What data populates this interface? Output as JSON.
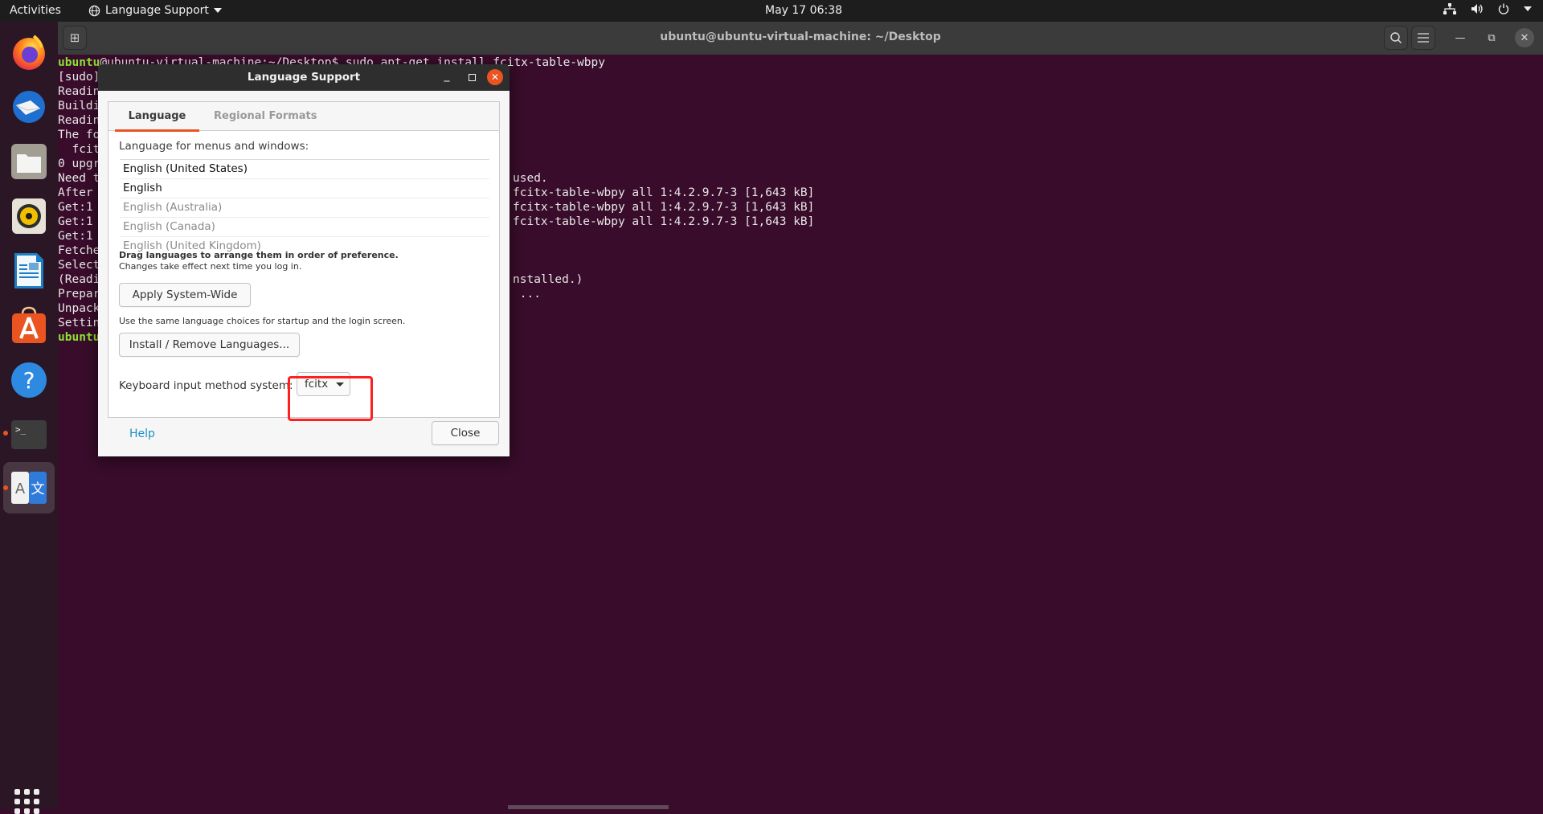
{
  "topbar": {
    "activities": "Activities",
    "app_menu": "Language Support",
    "clock": "May 17  06:38",
    "tray_icons": [
      "network-icon",
      "volume-icon",
      "power-icon",
      "system-menu-arrow"
    ]
  },
  "dock": {
    "items": [
      {
        "name": "firefox",
        "icon": "firefox-icon"
      },
      {
        "name": "thunderbird",
        "icon": "thunderbird-icon"
      },
      {
        "name": "files",
        "icon": "files-icon"
      },
      {
        "name": "rhythmbox",
        "icon": "rhythmbox-icon"
      },
      {
        "name": "libreoffice-writer",
        "icon": "writer-icon"
      },
      {
        "name": "ubuntu-software",
        "icon": "software-icon"
      },
      {
        "name": "help",
        "icon": "help-icon"
      },
      {
        "name": "terminal",
        "icon": "terminal-icon",
        "running": true
      },
      {
        "name": "language-support",
        "icon": "language-icon",
        "running": true,
        "active": true
      }
    ],
    "show_apps": "show-applications-icon"
  },
  "terminal": {
    "title": "ubuntu@ubuntu-virtual-machine: ~/Desktop",
    "first_line_prompt": "ubuntu",
    "first_line_obscured": "@ubuntu-virtual-machine:~/Desktop$ sudo apt-get install ",
    "first_line_tail": "fcitx-table-wbpy",
    "left_fragments": [
      "[sudo]",
      "Readin",
      "Buildi",
      "Readin",
      "The fo",
      "  fcit",
      "0 upgr",
      "Need t",
      "After",
      "Get:1",
      "Get:1",
      "Get:1",
      "Fetche",
      "Select",
      "(Readi",
      "Prepar",
      "Unpack",
      "Settin"
    ],
    "last_prompt": "ubuntu",
    "right_fragments": [
      {
        "row": 8,
        "text": "used."
      },
      {
        "row": 9,
        "text": "fcitx-table-wbpy all 1:4.2.9.7-3 [1,643 kB]"
      },
      {
        "row": 10,
        "text": "fcitx-table-wbpy all 1:4.2.9.7-3 [1,643 kB]"
      },
      {
        "row": 11,
        "text": "fcitx-table-wbpy all 1:4.2.9.7-3 [1,643 kB]"
      },
      {
        "row": 15,
        "text": "nstalled.)"
      },
      {
        "row": 16,
        "text": " ..."
      }
    ]
  },
  "dialog": {
    "title": "Language Support",
    "tabs": [
      {
        "label": "Language",
        "active": true
      },
      {
        "label": "Regional Formats",
        "active": false
      }
    ],
    "menus_label": "Language for menus and windows:",
    "languages": [
      {
        "label": "English (United States)",
        "primary": true
      },
      {
        "label": "English",
        "primary": true
      },
      {
        "label": "English (Australia)",
        "primary": false
      },
      {
        "label": "English (Canada)",
        "primary": false
      },
      {
        "label": "English (United Kingdom)",
        "primary": false
      }
    ],
    "drag_hint": "Drag languages to arrange them in order of preference.",
    "effect_hint": "Changes take effect next time you log in.",
    "apply_button": "Apply System-Wide",
    "apply_hint": "Use the same language choices for startup and the login screen.",
    "install_button": "Install / Remove Languages...",
    "keyboard_label": "Keyboard input method system:",
    "keyboard_value": "fcitx",
    "help_link": "Help",
    "close_button": "Close"
  },
  "colors": {
    "accent": "#e95420",
    "terminal_bg": "#380c2a",
    "prompt_green": "#8ae234",
    "highlight_red": "#ff1f1f",
    "link_blue": "#1a8fc7"
  }
}
